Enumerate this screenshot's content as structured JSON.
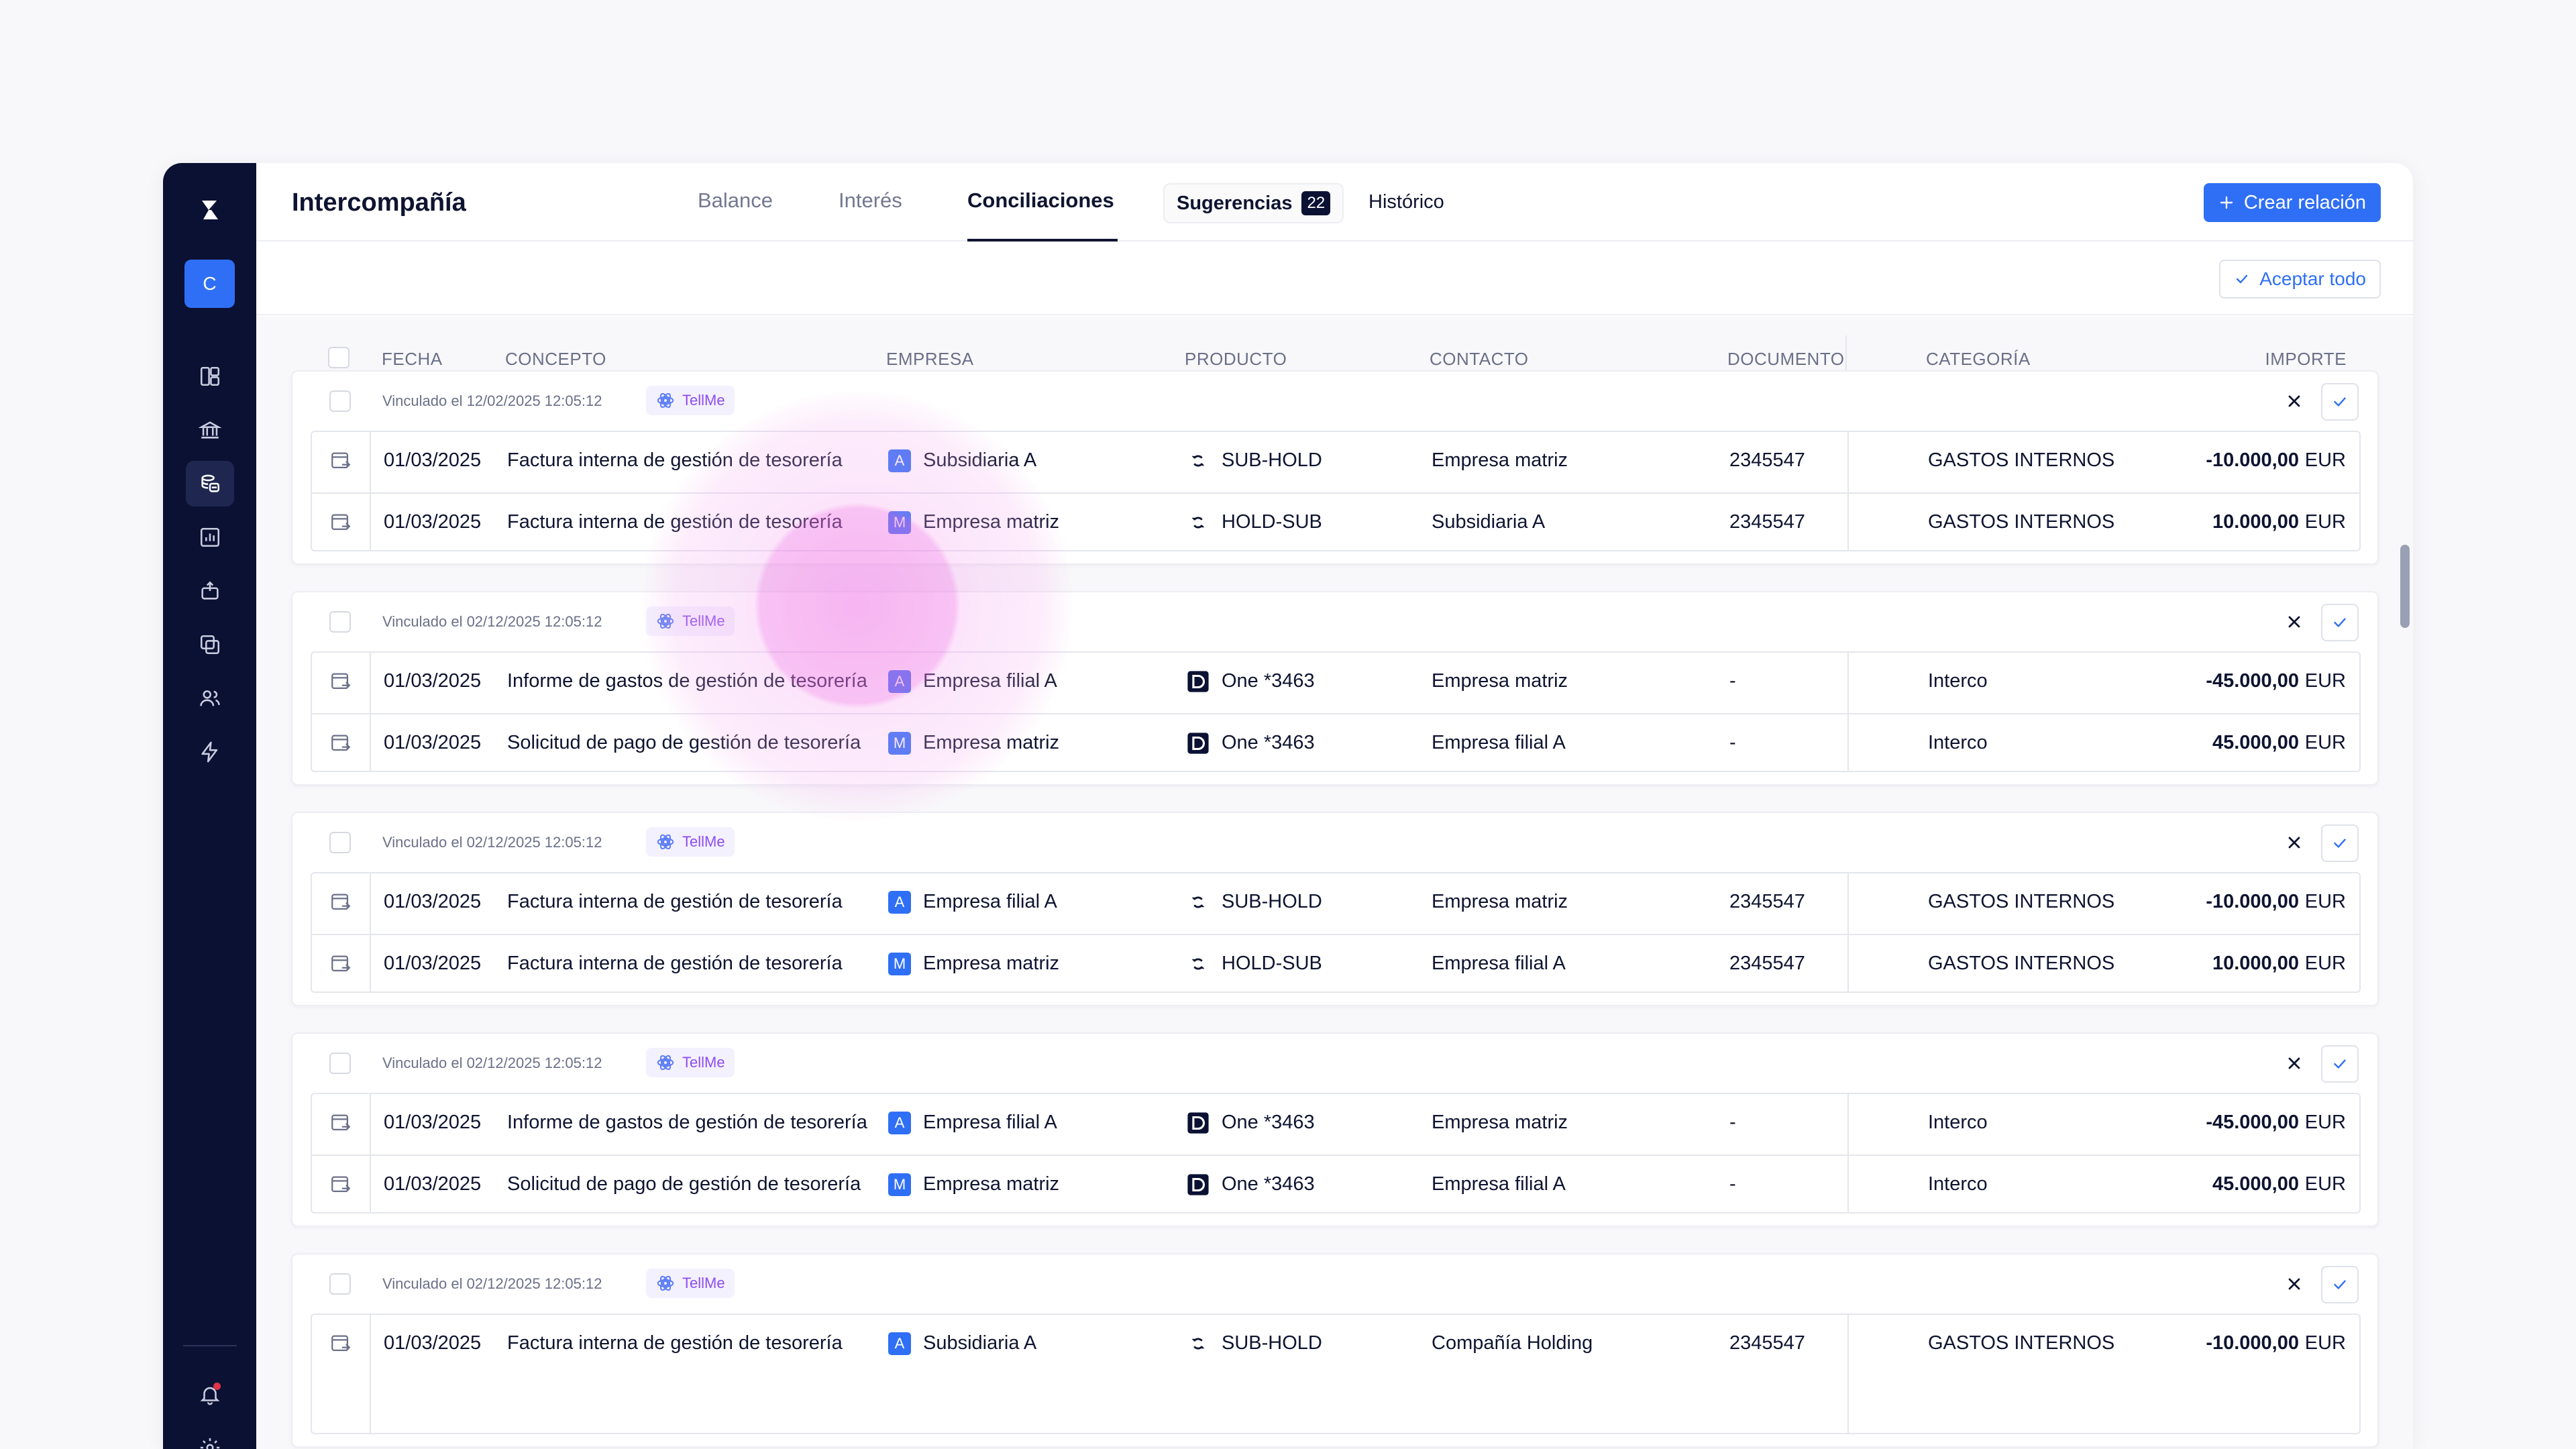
{
  "header": {
    "title": "Intercompañía",
    "tabs": [
      "Balance",
      "Interés",
      "Conciliaciones"
    ],
    "suggestions_label": "Sugerencias",
    "suggestions_count": "22",
    "history_label": "Histórico",
    "create_label": "Crear relación"
  },
  "sidebar": {
    "avatar": "C"
  },
  "toolbar": {
    "accept_all": "Aceptar todo"
  },
  "table": {
    "columns": [
      "FECHA",
      "CONCEPTO",
      "EMPRESA",
      "PRODUCTO",
      "CONTACTO",
      "DOCUMENTO",
      "CATEGORÍA",
      "IMPORTE"
    ]
  },
  "tellme_label": "TellMe",
  "groups": [
    {
      "linked": "Vinculado el 12/02/2025 12:05:12",
      "rows": [
        {
          "date": "01/03/2025",
          "concept": "Factura interna de gestión de tesorería",
          "entity_badge": "A",
          "entity": "Subsidiaria A",
          "product": "SUB-HOLD",
          "contact": "Empresa matriz",
          "document": "2345547",
          "category": "GASTOS INTERNOS",
          "amount": "-10.000,00",
          "currency": "EUR"
        },
        {
          "date": "01/03/2025",
          "concept": "Factura interna de gestión de tesorería",
          "entity_badge": "M",
          "entity": "Empresa matriz",
          "product": "HOLD-SUB",
          "contact": "Subsidiaria A",
          "document": "2345547",
          "category": "GASTOS INTERNOS",
          "amount": "10.000,00",
          "currency": "EUR"
        }
      ]
    },
    {
      "linked": "Vinculado el 02/12/2025 12:05:12",
      "rows": [
        {
          "date": "01/03/2025",
          "concept": "Informe de gastos de gestión de tesorería",
          "entity_badge": "A",
          "entity": "Empresa filial A",
          "product": "One *3463",
          "contact": "Empresa matriz",
          "document": "-",
          "category": "Interco",
          "amount": "-45.000,00",
          "currency": "EUR"
        },
        {
          "date": "01/03/2025",
          "concept": "Solicitud de pago de gestión de tesorería",
          "entity_badge": "M",
          "entity": "Empresa matriz",
          "product": "One *3463",
          "contact": "Empresa filial A",
          "document": "-",
          "category": "Interco",
          "amount": "45.000,00",
          "currency": "EUR"
        }
      ]
    },
    {
      "linked": "Vinculado el 02/12/2025 12:05:12",
      "rows": [
        {
          "date": "01/03/2025",
          "concept": "Factura interna de gestión de tesorería",
          "entity_badge": "A",
          "entity": "Empresa filial A",
          "product": "SUB-HOLD",
          "contact": "Empresa matriz",
          "document": "2345547",
          "category": "GASTOS INTERNOS",
          "amount": "-10.000,00",
          "currency": "EUR"
        },
        {
          "date": "01/03/2025",
          "concept": "Factura interna de gestión de tesorería",
          "entity_badge": "M",
          "entity": "Empresa matriz",
          "product": "HOLD-SUB",
          "contact": "Empresa filial A",
          "document": "2345547",
          "category": "GASTOS INTERNOS",
          "amount": "10.000,00",
          "currency": "EUR"
        }
      ]
    },
    {
      "linked": "Vinculado el 02/12/2025 12:05:12",
      "rows": [
        {
          "date": "01/03/2025",
          "concept": "Informe de gastos de gestión de tesorería",
          "entity_badge": "A",
          "entity": "Empresa filial A",
          "product": "One *3463",
          "contact": "Empresa matriz",
          "document": "-",
          "category": "Interco",
          "amount": "-45.000,00",
          "currency": "EUR"
        },
        {
          "date": "01/03/2025",
          "concept": "Solicitud de pago de gestión de tesorería",
          "entity_badge": "M",
          "entity": "Empresa matriz",
          "product": "One *3463",
          "contact": "Empresa filial A",
          "document": "-",
          "category": "Interco",
          "amount": "45.000,00",
          "currency": "EUR"
        }
      ]
    },
    {
      "linked": "Vinculado el 02/12/2025 12:05:12",
      "rows": [
        {
          "date": "01/03/2025",
          "concept": "Factura interna de gestión de tesorería",
          "entity_badge": "A",
          "entity": "Subsidiaria A",
          "product": "SUB-HOLD",
          "contact": "Compañía Holding",
          "document": "2345547",
          "category": "GASTOS INTERNOS",
          "amount": "-10.000,00",
          "currency": "EUR"
        }
      ]
    }
  ]
}
